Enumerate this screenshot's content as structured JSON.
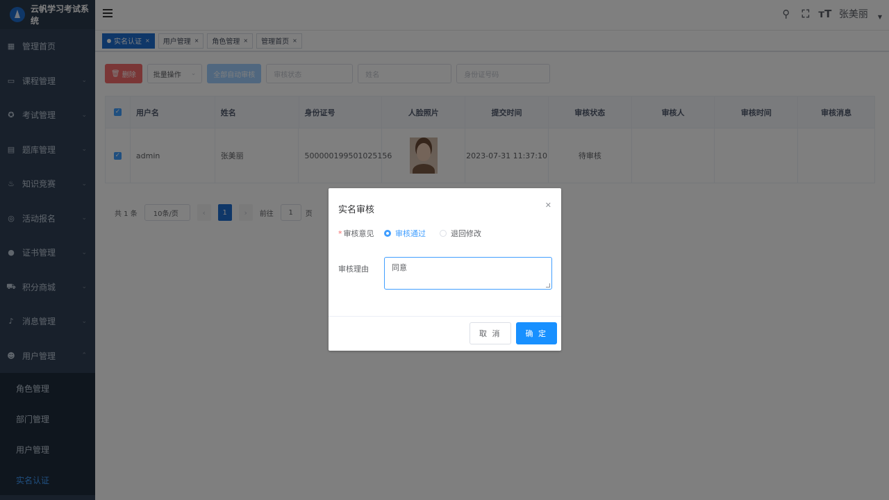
{
  "app": {
    "title": "云帆学习考试系统"
  },
  "sidebar": {
    "items": [
      {
        "label": "管理首页",
        "icon": "dashboard-icon",
        "has_children": false
      },
      {
        "label": "课程管理",
        "icon": "monitor-icon",
        "has_children": true
      },
      {
        "label": "考试管理",
        "icon": "gear-icon",
        "has_children": true
      },
      {
        "label": "题库管理",
        "icon": "document-icon",
        "has_children": true
      },
      {
        "label": "知识竞赛",
        "icon": "fire-icon",
        "has_children": true
      },
      {
        "label": "活动报名",
        "icon": "target-icon",
        "has_children": true
      },
      {
        "label": "证书管理",
        "icon": "certificate-icon",
        "has_children": true
      },
      {
        "label": "积分商城",
        "icon": "cart-icon",
        "has_children": true
      },
      {
        "label": "消息管理",
        "icon": "bell-icon",
        "has_children": true
      },
      {
        "label": "用户管理",
        "icon": "user-icon",
        "has_children": true,
        "expanded": true
      }
    ],
    "submenu": [
      {
        "label": "角色管理",
        "active": false
      },
      {
        "label": "部门管理",
        "active": false
      },
      {
        "label": "用户管理",
        "active": false
      },
      {
        "label": "实名认证",
        "active": true
      }
    ]
  },
  "header": {
    "username": "张美丽",
    "icons": [
      "search-icon",
      "fullscreen-icon",
      "font-size-icon"
    ]
  },
  "tags": [
    {
      "label": "实名认证",
      "active": true
    },
    {
      "label": "用户管理",
      "active": false
    },
    {
      "label": "角色管理",
      "active": false
    },
    {
      "label": "管理首页",
      "active": false
    }
  ],
  "toolbar": {
    "delete_label": "删除",
    "batch_label": "批量操作",
    "auto_audit_label": "全部自动审核",
    "filters": [
      {
        "placeholder": "审核状态"
      },
      {
        "placeholder": "姓名"
      },
      {
        "placeholder": "身份证号码"
      }
    ]
  },
  "table": {
    "columns": [
      "用户名",
      "姓名",
      "身份证号",
      "人脸照片",
      "提交时间",
      "审核状态",
      "审核人",
      "审核时间",
      "审核消息"
    ],
    "rows": [
      {
        "username": "admin",
        "name": "张美丽",
        "id_number": "500000199501025156",
        "submit_time": "2023-07-31 11:37:10",
        "status": "待审核",
        "auditor": "",
        "audit_time": "",
        "message": ""
      }
    ]
  },
  "pagination": {
    "total_text": "共 1 条",
    "page_size": "10条/页",
    "current_page": "1",
    "goto_prefix": "前往",
    "goto_value": "1",
    "goto_suffix": "页"
  },
  "dialog": {
    "title": "实名审核",
    "opinion_label": "审核意见",
    "options": [
      "审核通过",
      "退回修改"
    ],
    "selected_option": "审核通过",
    "reason_label": "审核理由",
    "reason_value": "同意",
    "cancel_label": "取 消",
    "confirm_label": "确 定"
  },
  "colors": {
    "sidebar_bg": "#304156",
    "primary": "#1890ff",
    "danger": "#f56c6c",
    "active_tag": "#1f6fd1"
  }
}
